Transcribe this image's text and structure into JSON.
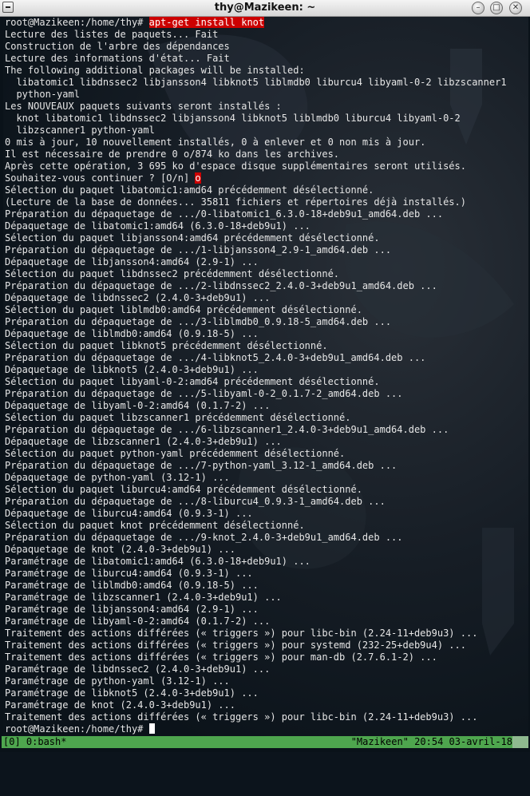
{
  "window": {
    "title": "thy@Mazikeen: ~",
    "menu_icon": "window-menu-icon",
    "buttons": [
      "minimize-icon",
      "maximize-icon",
      "close-icon"
    ]
  },
  "terminal": {
    "prompt": "root@Mazikeen:/home/thy#",
    "command": "apt-get install knot",
    "lines_before_answer": [
      "Lecture des listes de paquets... Fait",
      "Construction de l'arbre des dépendances",
      "Lecture des informations d'état... Fait",
      "The following additional packages will be installed:",
      "  libatomic1 libdnssec2 libjansson4 libknot5 liblmdb0 liburcu4 libyaml-0-2 libzscanner1",
      "  python-yaml",
      "Les NOUVEAUX paquets suivants seront installés :",
      "  knot libatomic1 libdnssec2 libjansson4 libknot5 liblmdb0 liburcu4 libyaml-0-2",
      "  libzscanner1 python-yaml",
      "0 mis à jour, 10 nouvellement installés, 0 à enlever et 0 non mis à jour.",
      "Il est nécessaire de prendre 0 o/874 ko dans les archives.",
      "Après cette opération, 3 695 ko d'espace disque supplémentaires seront utilisés."
    ],
    "question": "Souhaitez-vous continuer ? [O/n] ",
    "answer": "o",
    "lines_after_answer": [
      "Sélection du paquet libatomic1:amd64 précédemment désélectionné.",
      "(Lecture de la base de données... 35811 fichiers et répertoires déjà installés.)",
      "Préparation du dépaquetage de .../0-libatomic1_6.3.0-18+deb9u1_amd64.deb ...",
      "Dépaquetage de libatomic1:amd64 (6.3.0-18+deb9u1) ...",
      "Sélection du paquet libjansson4:amd64 précédemment désélectionné.",
      "Préparation du dépaquetage de .../1-libjansson4_2.9-1_amd64.deb ...",
      "Dépaquetage de libjansson4:amd64 (2.9-1) ...",
      "Sélection du paquet libdnssec2 précédemment désélectionné.",
      "Préparation du dépaquetage de .../2-libdnssec2_2.4.0-3+deb9u1_amd64.deb ...",
      "Dépaquetage de libdnssec2 (2.4.0-3+deb9u1) ...",
      "Sélection du paquet liblmdb0:amd64 précédemment désélectionné.",
      "Préparation du dépaquetage de .../3-liblmdb0_0.9.18-5_amd64.deb ...",
      "Dépaquetage de liblmdb0:amd64 (0.9.18-5) ...",
      "Sélection du paquet libknot5 précédemment désélectionné.",
      "Préparation du dépaquetage de .../4-libknot5_2.4.0-3+deb9u1_amd64.deb ...",
      "Dépaquetage de libknot5 (2.4.0-3+deb9u1) ...",
      "Sélection du paquet libyaml-0-2:amd64 précédemment désélectionné.",
      "Préparation du dépaquetage de .../5-libyaml-0-2_0.1.7-2_amd64.deb ...",
      "Dépaquetage de libyaml-0-2:amd64 (0.1.7-2) ...",
      "Sélection du paquet libzscanner1 précédemment désélectionné.",
      "Préparation du dépaquetage de .../6-libzscanner1_2.4.0-3+deb9u1_amd64.deb ...",
      "Dépaquetage de libzscanner1 (2.4.0-3+deb9u1) ...",
      "Sélection du paquet python-yaml précédemment désélectionné.",
      "Préparation du dépaquetage de .../7-python-yaml_3.12-1_amd64.deb ...",
      "Dépaquetage de python-yaml (3.12-1) ...",
      "Sélection du paquet liburcu4:amd64 précédemment désélectionné.",
      "Préparation du dépaquetage de .../8-liburcu4_0.9.3-1_amd64.deb ...",
      "Dépaquetage de liburcu4:amd64 (0.9.3-1) ...",
      "Sélection du paquet knot précédemment désélectionné.",
      "Préparation du dépaquetage de .../9-knot_2.4.0-3+deb9u1_amd64.deb ...",
      "Dépaquetage de knot (2.4.0-3+deb9u1) ...",
      "Paramétrage de libatomic1:amd64 (6.3.0-18+deb9u1) ...",
      "Paramétrage de liburcu4:amd64 (0.9.3-1) ...",
      "Paramétrage de liblmdb0:amd64 (0.9.18-5) ...",
      "Paramétrage de libzscanner1 (2.4.0-3+deb9u1) ...",
      "Paramétrage de libjansson4:amd64 (2.9-1) ...",
      "Paramétrage de libyaml-0-2:amd64 (0.1.7-2) ...",
      "Traitement des actions différées (« triggers ») pour libc-bin (2.24-11+deb9u3) ...",
      "Traitement des actions différées (« triggers ») pour systemd (232-25+deb9u4) ...",
      "Traitement des actions différées (« triggers ») pour man-db (2.7.6.1-2) ...",
      "Paramétrage de libdnssec2 (2.4.0-3+deb9u1) ...",
      "Paramétrage de python-yaml (3.12-1) ...",
      "Paramétrage de libknot5 (2.4.0-3+deb9u1) ...",
      "Paramétrage de knot (2.4.0-3+deb9u1) ...",
      "Traitement des actions différées (« triggers ») pour libc-bin (2.24-11+deb9u3) ..."
    ],
    "final_prompt": "root@Mazikeen:/home/thy#"
  },
  "statusbar": {
    "left": "[0] 0:bash*",
    "right": "\"Mazikeen\" 20:54 03-avril-18",
    "color": "#4ea64e"
  },
  "colors": {
    "command_highlight": "#cc0000",
    "background": "#0a1219",
    "text": "#e6e6e6"
  }
}
